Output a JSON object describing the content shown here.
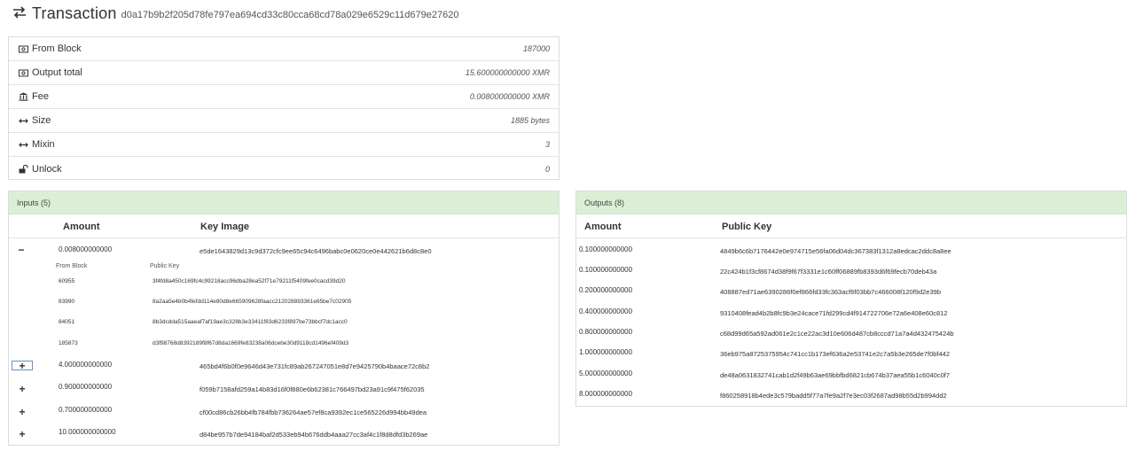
{
  "header": {
    "title": "Transaction",
    "hash": "d0a17b9b2f205d78fe797ea694cd33c80cca68cd78a029e6529c11d679e27620"
  },
  "summary": [
    {
      "icon": "money-icon",
      "label": "From Block",
      "value": "187000"
    },
    {
      "icon": "money-icon",
      "label": "Output total",
      "value": "15.600000000000 XMR"
    },
    {
      "icon": "bank-icon",
      "label": "Fee",
      "value": "0.008000000000 XMR"
    },
    {
      "icon": "arrows-horizontal-icon",
      "label": "Size",
      "value": "1885 bytes"
    },
    {
      "icon": "arrows-horizontal-icon",
      "label": "Mixin",
      "value": "3"
    },
    {
      "icon": "unlock-icon",
      "label": "Unlock",
      "value": "0"
    }
  ],
  "inputs": {
    "title": "Inputs (5)",
    "col_amount": "Amount",
    "col_key": "Key Image",
    "sub_from_block": "From Block",
    "sub_public_key": "Public Key",
    "rows": [
      {
        "toggle": "−",
        "amount": "0.008000000000",
        "key_image": "e5de1643829d13c9d372cfc9ee65c94c6496babc0e0620ce0e442621b6d8c8e0",
        "expanded": true,
        "mixins": [
          {
            "block": "60955",
            "key": "3f4fd8a450c169fc4c99218acc96dba28ea52f71e79211f5409fee0cacd39d20"
          },
          {
            "block": "83990",
            "key": "8a2aa5e4b0b4fefdd114e80d8e665909628faacc212028893361e65be7c02905"
          },
          {
            "block": "84051",
            "key": "8b3dcdda515aaeaf7af19ae3c328b3e33411f83d6233f897be73bbcf7dc1acc0"
          },
          {
            "block": "185873",
            "key": "d3f98768d8392189f8f67d8da1669fe83238a06dcebe30d9118cd1496ef409d3"
          }
        ]
      },
      {
        "toggle": "+",
        "amount": "4.000000000000",
        "key_image": "465bd4f6b0f0e9646d43e731fc89ab267247051e8d7e9425790b4baace72c8b2"
      },
      {
        "toggle": "+",
        "amount": "0.900000000000",
        "key_image": "f059b7158afd259a14b83d16f0f880e6b62381c766497bd23a91c9f475f62035"
      },
      {
        "toggle": "+",
        "amount": "0.700000000000",
        "key_image": "cf00cd86cb26bb4fb784fbb736264ae57ef8ca9392ec1ce565226d994bb49dea"
      },
      {
        "toggle": "+",
        "amount": "10.000000000000",
        "key_image": "d84be957b7de94184baf2d533eb94b676ddb4aaa27cc3af4c1f8d8dfd3b269ae"
      }
    ]
  },
  "outputs": {
    "title": "Outputs (8)",
    "col_amount": "Amount",
    "col_key": "Public Key",
    "rows": [
      {
        "amount": "0.100000000000",
        "key": "4849b6c6b7176442e0e974715e56fa06d04dc367383f1312a8edcac2ddc8a8ee"
      },
      {
        "amount": "0.100000000000",
        "key": "22c424b1f3cf8674d38f9f67f3331e1c60ff06889fb8393d6f69fecb70deb43a"
      },
      {
        "amount": "0.200000000000",
        "key": "408887ed71ae6390286f0ef866fd33fc363acf6f03bb7c466008f120f9d2e39b"
      },
      {
        "amount": "0.400000000000",
        "key": "9310408fead4b2b8fc9b3e24cace71fd299cd4f914722706e72a6e408e60c812"
      },
      {
        "amount": "0.800000000000",
        "key": "c68d99d65a592ad061e2c1ce22ac3d10e606d487cb8cccd71a7a4d432475424b"
      },
      {
        "amount": "1.000000000000",
        "key": "36eb975a8725375954c741cc1b173ef636a2e53741e2c7a5b3e265de7f0bf442"
      },
      {
        "amount": "5.000000000000",
        "key": "de48a0631832741cab1d2f49b63ae69bbfbd6821cb674b37aea55b1c6040c0f7"
      },
      {
        "amount": "8.000000000000",
        "key": "f860258918b4ede3c579badd5f77a7fe9a2f7e3ec03f2687ad98b55d2b994dd2"
      }
    ]
  }
}
